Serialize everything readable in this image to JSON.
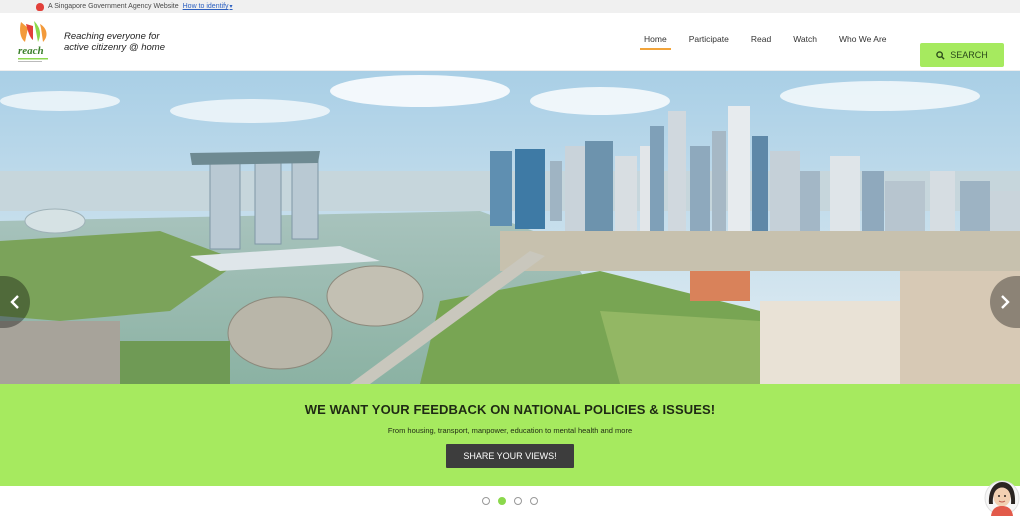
{
  "gov_bar": {
    "text": "A Singapore Government Agency Website",
    "link": "How to identify"
  },
  "header": {
    "logo_text": "reach",
    "tagline_line1": "Reaching everyone for",
    "tagline_line2": "active citizenry @ home"
  },
  "nav": {
    "items": [
      {
        "label": "Home",
        "active": true
      },
      {
        "label": "Participate"
      },
      {
        "label": "Read"
      },
      {
        "label": "Watch"
      },
      {
        "label": "Who We Are"
      }
    ],
    "search_label": "SEARCH"
  },
  "hero": {
    "image": "singapore-marina-bay-skyline"
  },
  "feedback": {
    "heading": "WE WANT YOUR FEEDBACK ON NATIONAL POLICIES & ISSUES!",
    "subtext": "From housing, transport, manpower, education to mental health and more",
    "button": "SHARE YOUR VIEWS!"
  },
  "carousel": {
    "slide_count": 4,
    "active_index": 1
  },
  "colors": {
    "accent_green": "#a6ea5f",
    "active_underline": "#f2a43a",
    "button_dark": "#3d3d3d"
  }
}
